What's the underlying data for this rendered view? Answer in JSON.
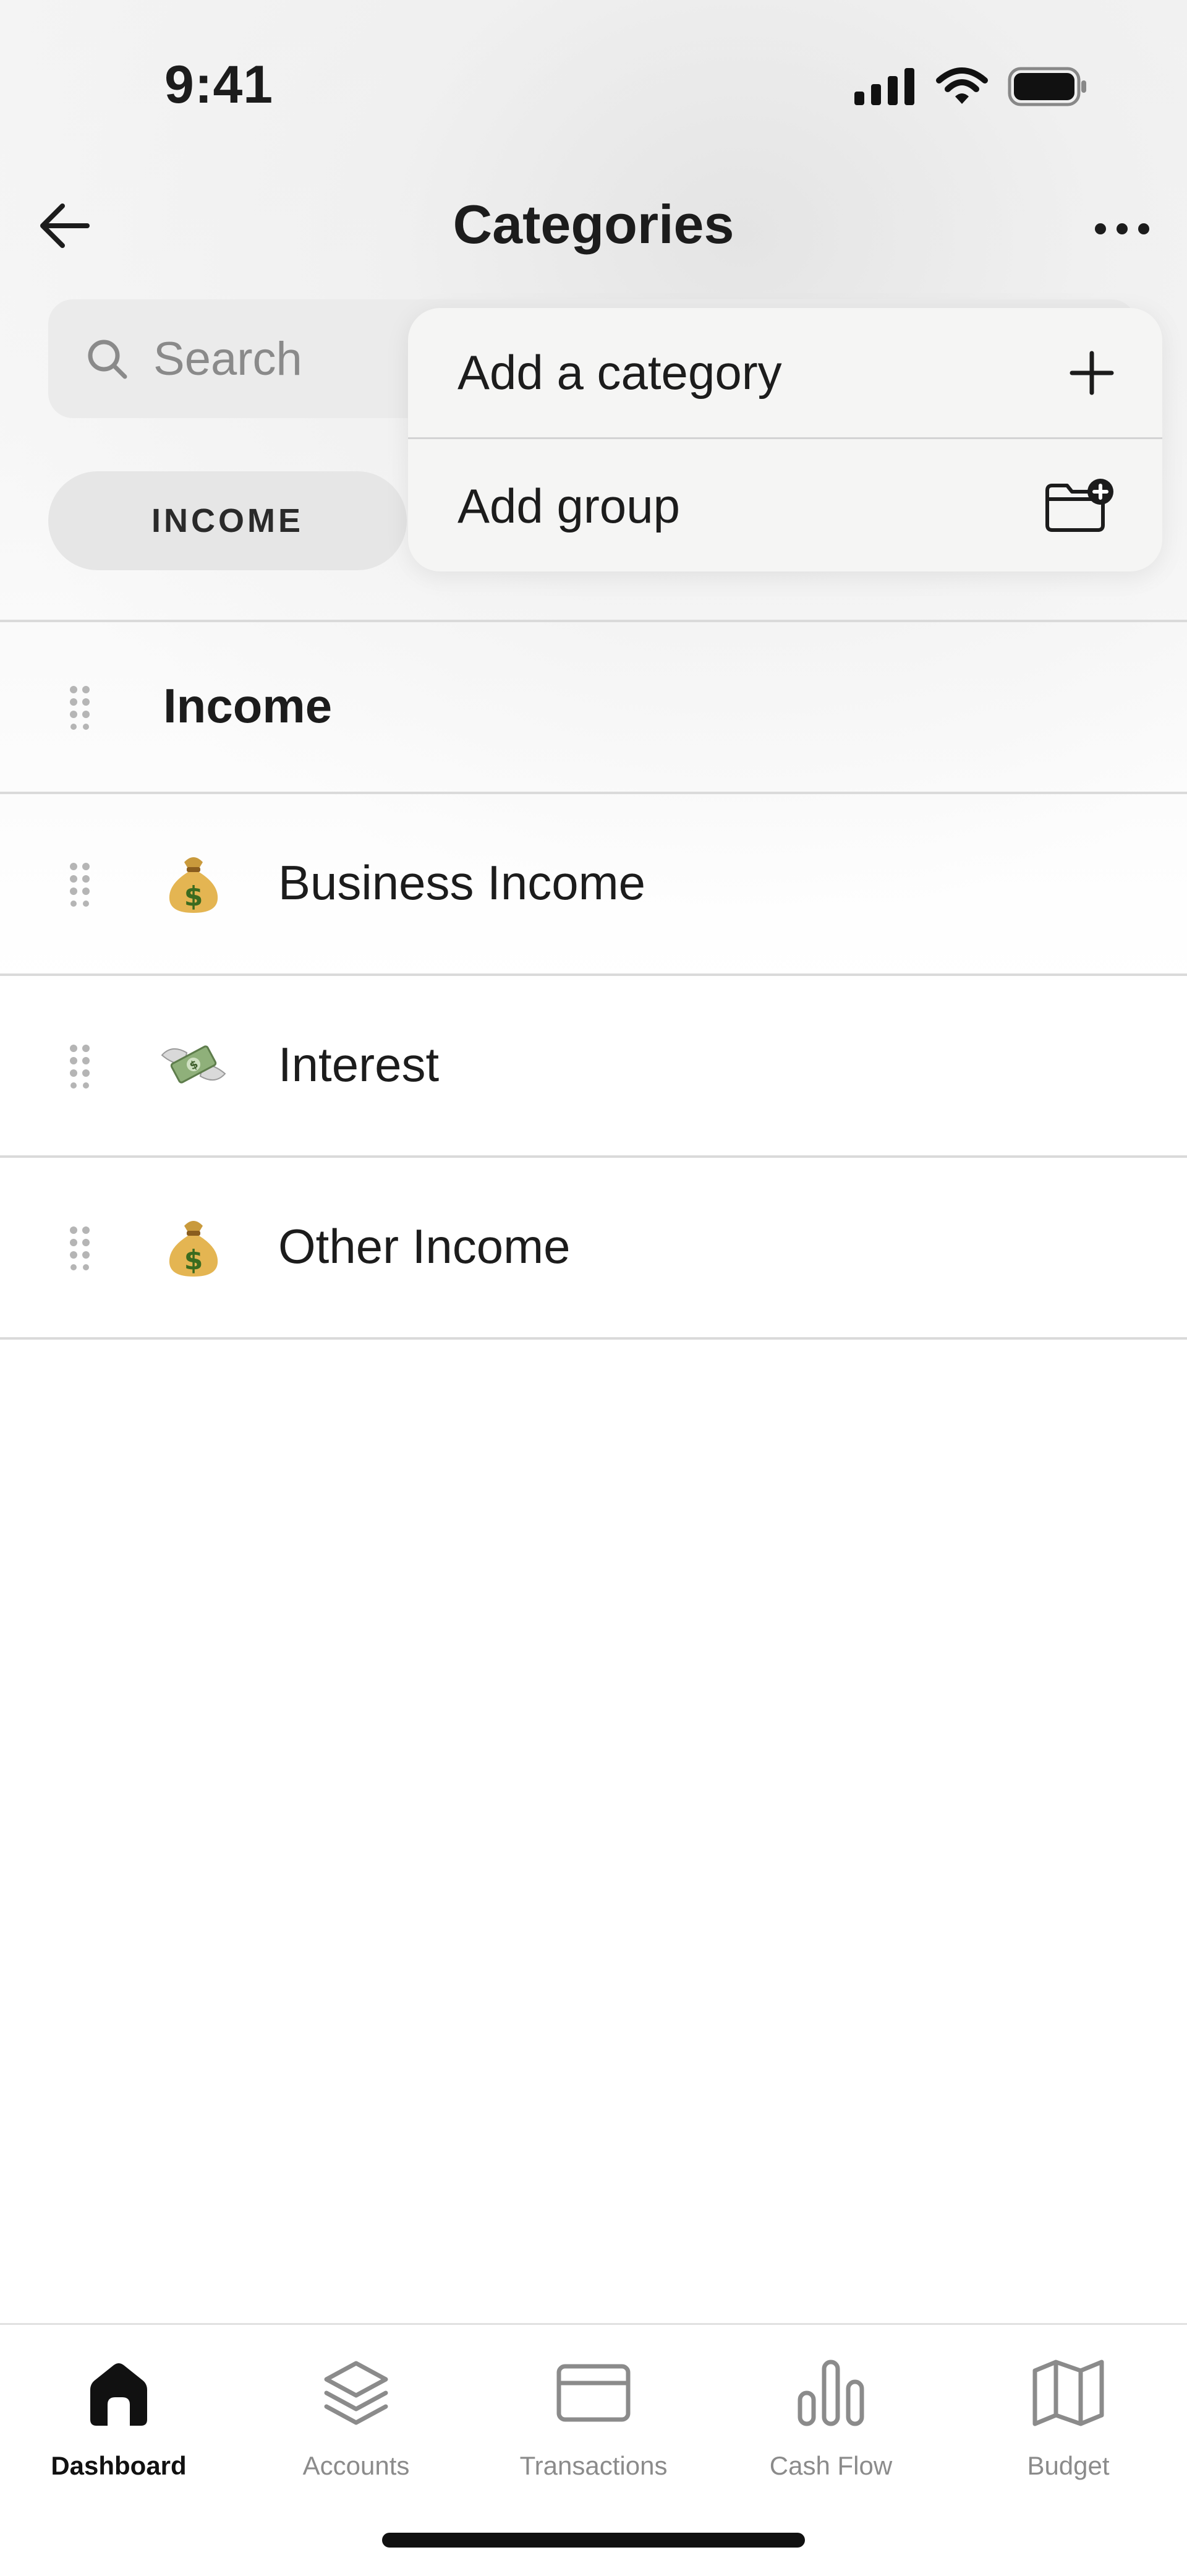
{
  "status_bar": {
    "time": "9:41"
  },
  "nav": {
    "title": "Categories"
  },
  "search": {
    "placeholder": "Search"
  },
  "filter_pill": {
    "label": "INCOME"
  },
  "menu": {
    "items": [
      {
        "label": "Add a category",
        "icon": "plus-icon"
      },
      {
        "label": "Add group",
        "icon": "folder-plus-icon"
      }
    ]
  },
  "list": {
    "group": {
      "label": "Income"
    },
    "items": [
      {
        "label": "Business Income",
        "emoji": "money-bag"
      },
      {
        "label": "Interest",
        "emoji": "money-with-wings"
      },
      {
        "label": "Other Income",
        "emoji": "money-bag"
      }
    ]
  },
  "tabbar": {
    "items": [
      {
        "label": "Dashboard",
        "icon": "home-icon",
        "active": true
      },
      {
        "label": "Accounts",
        "icon": "layers-icon",
        "active": false
      },
      {
        "label": "Transactions",
        "icon": "card-icon",
        "active": false
      },
      {
        "label": "Cash Flow",
        "icon": "bar-chart-icon",
        "active": false
      },
      {
        "label": "Budget",
        "icon": "map-icon",
        "active": false
      }
    ]
  },
  "colors": {
    "accent": "#111111",
    "inactive": "#8b8b8b",
    "divider": "#dadada"
  }
}
